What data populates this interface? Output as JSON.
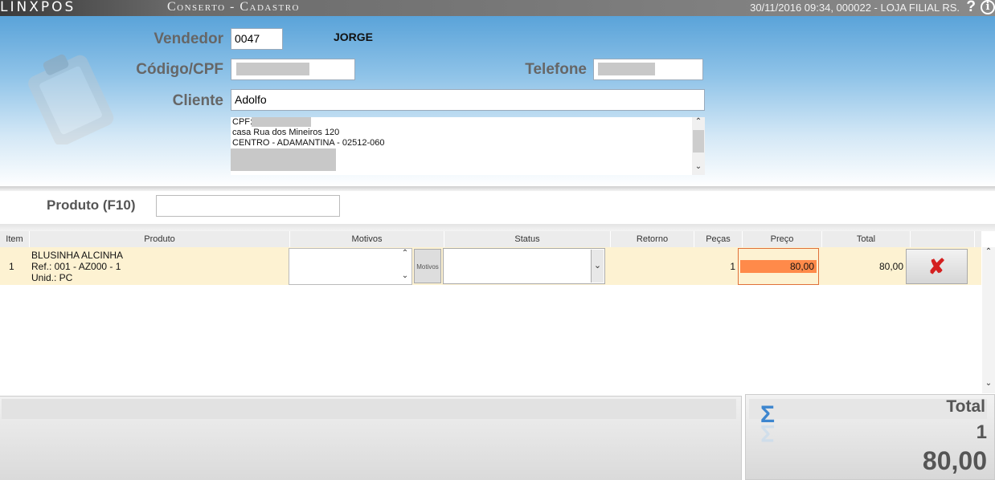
{
  "titlebar": {
    "logo": "LINXPOS",
    "title": "Conserto - Cadastro",
    "status": "30/11/2016 09:34, 000022 - LOJA FILIAL RS.",
    "help": "?",
    "info": "i"
  },
  "form": {
    "vendedor_label": "Vendedor",
    "vendedor_code": "0047",
    "vendedor_name": "JORGE",
    "codigo_label": "Código/CPF",
    "telefone_label": "Telefone",
    "cliente_label": "Cliente",
    "cliente_value": "Adolfo",
    "address_lines": [
      "CPF:",
      "casa Rua dos Mineiros 120",
      "CENTRO - ADAMANTINA - 02512-060"
    ]
  },
  "produto": {
    "label": "Produto (F10)",
    "value": ""
  },
  "table": {
    "headers": [
      "Item",
      "Produto",
      "Motivos",
      "Status",
      "Retorno",
      "Peças",
      "Preço",
      "Total"
    ],
    "rows": [
      {
        "item": "1",
        "produto_lines": [
          "BLUSINHA ALCINHA",
          "Ref.: 001 - AZ000 - 1",
          "Unid.: PC"
        ],
        "motivos_button": "Motivos",
        "status": "",
        "retorno": "",
        "pecas": "1",
        "preco": "80,00",
        "total": "80,00"
      }
    ]
  },
  "footer": {
    "total_label": "Total",
    "total_qty": "1",
    "total_value": "80,00"
  }
}
